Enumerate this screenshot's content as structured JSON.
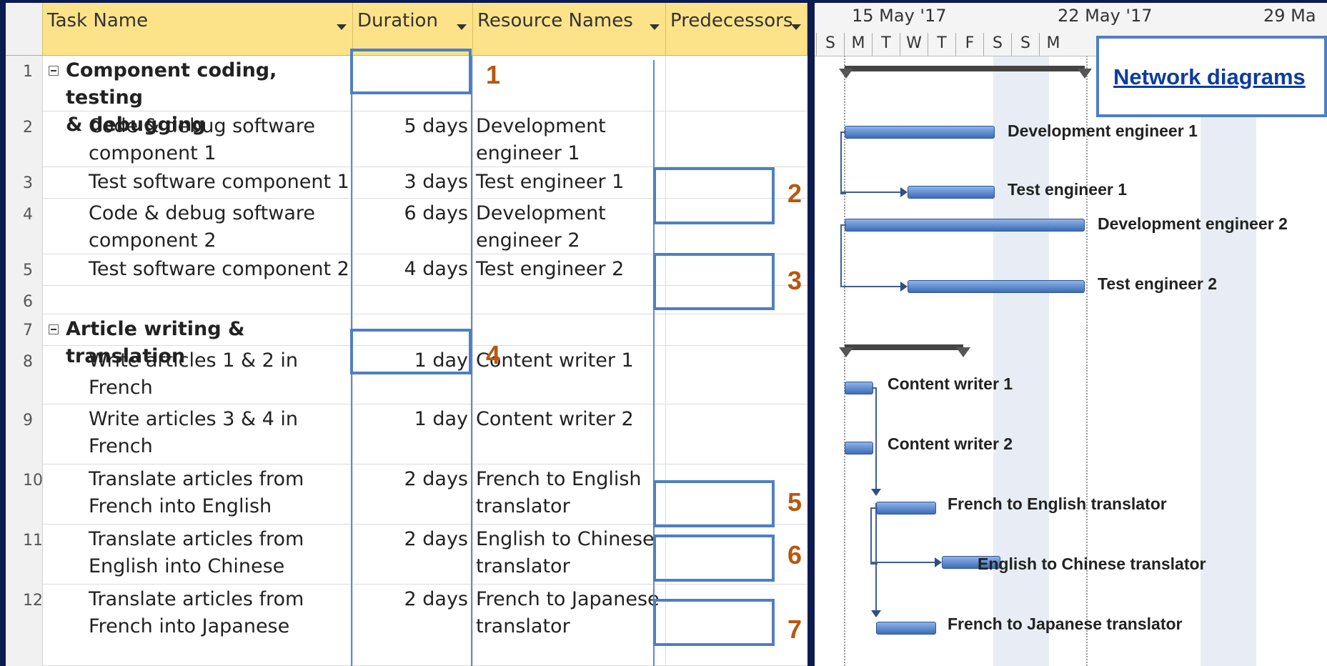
{
  "columns": {
    "task_name": "Task Name",
    "duration": "Duration",
    "resource_names": "Resource Names",
    "predecessors": "Predecessors"
  },
  "rows": [
    {
      "id": "1",
      "name_l1": "Component coding, testing",
      "name_l2": "& debugging",
      "duration": "",
      "res_l1": "",
      "res_l2": "",
      "summary": true
    },
    {
      "id": "2",
      "name_l1": "Code & debug software",
      "name_l2": "component 1",
      "duration": "5 days",
      "res_l1": "Development",
      "res_l2": "engineer 1"
    },
    {
      "id": "3",
      "name_l1": "Test software component 1",
      "name_l2": "",
      "duration": "3 days",
      "res_l1": "Test engineer 1",
      "res_l2": ""
    },
    {
      "id": "4",
      "name_l1": "Code & debug software",
      "name_l2": "component 2",
      "duration": "6 days",
      "res_l1": "Development",
      "res_l2": "engineer 2"
    },
    {
      "id": "5",
      "name_l1": "Test software component 2",
      "name_l2": "",
      "duration": "4 days",
      "res_l1": "Test engineer 2",
      "res_l2": ""
    },
    {
      "id": "6",
      "name_l1": "",
      "name_l2": "",
      "duration": "",
      "res_l1": "",
      "res_l2": ""
    },
    {
      "id": "7",
      "name_l1": "Article writing & translation",
      "name_l2": "",
      "duration": "",
      "res_l1": "",
      "res_l2": "",
      "summary": true
    },
    {
      "id": "8",
      "name_l1": "Write articles 1 & 2 in",
      "name_l2": "French",
      "duration": "1 day",
      "res_l1": "Content writer 1",
      "res_l2": ""
    },
    {
      "id": "9",
      "name_l1": "Write articles 3 & 4 in",
      "name_l2": "French",
      "duration": "1 day",
      "res_l1": "Content writer 2",
      "res_l2": ""
    },
    {
      "id": "10",
      "name_l1": "Translate articles from",
      "name_l2": "French into English",
      "duration": "2 days",
      "res_l1": "French to English",
      "res_l2": "translator"
    },
    {
      "id": "11",
      "name_l1": "Translate articles from",
      "name_l2": "English into Chinese",
      "duration": "2 days",
      "res_l1": "English to Chinese",
      "res_l2": "translator"
    },
    {
      "id": "12",
      "name_l1": "Translate articles from",
      "name_l2": "French into Japanese",
      "duration": "2 days",
      "res_l1": "French to Japanese",
      "res_l2": "translator"
    }
  ],
  "markers": [
    "1",
    "2",
    "3",
    "4",
    "5",
    "6",
    "7"
  ],
  "timescale": {
    "weeks": [
      "15 May '17",
      "22 May '17",
      "29 Ma"
    ],
    "days": [
      "S",
      "M",
      "T",
      "W",
      "T",
      "F",
      "S",
      "S",
      "M"
    ]
  },
  "bar_labels": {
    "dev1": "Development engineer 1",
    "test1": "Test engineer 1",
    "dev2": "Development engineer 2",
    "test2": "Test engineer 2",
    "cw1": "Content writer 1",
    "cw2": "Content writer 2",
    "fr_en": "French to English translator",
    "en_zh": "English to Chinese translator",
    "fr_ja": "French to Japanese translator"
  },
  "callout": {
    "label": "Network diagrams"
  },
  "colors": {
    "header_bg": "#fce38a",
    "marker_number": "#b8570f",
    "box_border": "#4e7fc4",
    "bar": "#3c6db5",
    "background": "#0c1b52"
  }
}
